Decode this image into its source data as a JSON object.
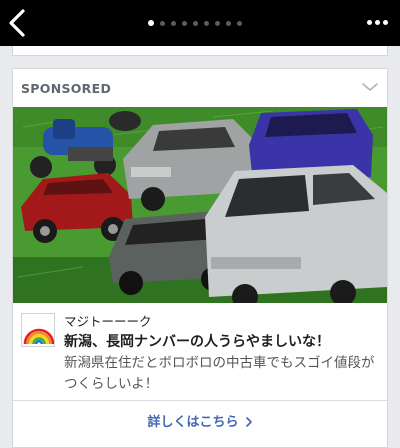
{
  "topbar": {
    "page_indicator": {
      "count": 9,
      "active_index": 0
    },
    "icons": {
      "back": "back-chevron-icon",
      "more": "more-horizontal-icon"
    }
  },
  "ad": {
    "label": "SPONSORED",
    "brand_name": "マジトーーーク",
    "headline": "新潟、長岡ナンバーの人うらやましいな！",
    "description": "新潟県在住だとボロボロの中古車でもスゴイ値段がつくらしいよ！",
    "cta_label": "詳しくはこちら",
    "icons": {
      "menu": "chevron-down-icon",
      "logo": "rainbow-logo",
      "cta": "chevron-right-icon"
    },
    "image_subject": "photo-of-toy-clay-cars-piled-on-grass"
  },
  "colors": {
    "topbar_bg": "#000000",
    "link_blue": "#4267b2",
    "grass_green": "#3e8c2a"
  }
}
